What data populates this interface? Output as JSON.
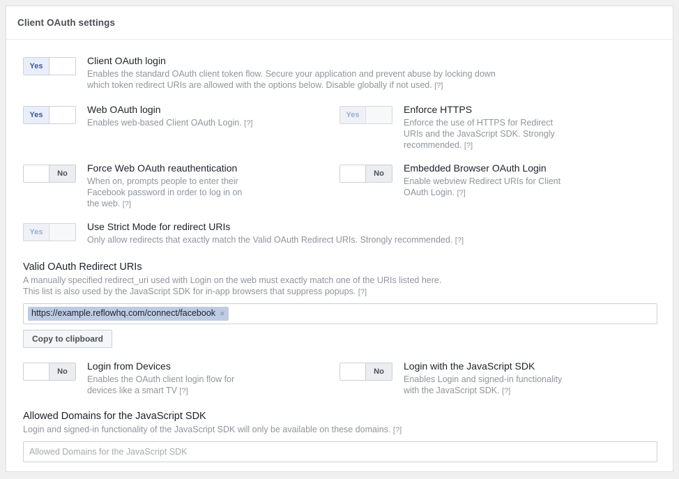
{
  "card": {
    "title": "Client OAuth settings"
  },
  "settings": [
    {
      "name": "client-oauth-login",
      "title": "Client OAuth login",
      "desc": "Enables the standard OAuth client token flow. Secure your application and prevent abuse by locking down which token redirect URIs are allowed with the options below. Disable globally if not used.",
      "help": "[?]",
      "state": "Yes",
      "on": true,
      "disabled": false
    },
    {
      "name": "web-oauth-login",
      "title": "Web OAuth login",
      "desc": "Enables web-based Client OAuth Login.",
      "help": "[?]",
      "state": "Yes",
      "on": true,
      "disabled": false
    },
    {
      "name": "enforce-https",
      "title": "Enforce HTTPS",
      "desc": "Enforce the use of HTTPS for Redirect URIs and the JavaScript SDK. Strongly recommended.",
      "help": "[?]",
      "state": "Yes",
      "on": true,
      "disabled": true
    },
    {
      "name": "force-web-oauth-reauthentication",
      "title": "Force Web OAuth reauthentication",
      "desc": "When on, prompts people to enter their Facebook password in order to log in on the web.",
      "help": "[?]",
      "state": "No",
      "on": false,
      "disabled": false
    },
    {
      "name": "embedded-browser-oauth-login",
      "title": "Embedded Browser OAuth Login",
      "desc": "Enable webview Redirect URIs for Client OAuth Login.",
      "help": "[?]",
      "state": "No",
      "on": false,
      "disabled": false
    },
    {
      "name": "use-strict-mode-for-redirect-uris",
      "title": "Use Strict Mode for redirect URIs",
      "desc": "Only allow redirects that exactly match the Valid OAuth Redirect URIs. Strongly recommended.",
      "help": "[?]",
      "state": "Yes",
      "on": true,
      "disabled": true
    },
    {
      "name": "login-from-devices",
      "title": "Login from Devices",
      "desc": "Enables the OAuth client login flow for devices like a smart TV",
      "help": "[?]",
      "state": "No",
      "on": false,
      "disabled": false
    },
    {
      "name": "login-with-the-javascript-sdk",
      "title": "Login with the JavaScript SDK",
      "desc": "Enables Login and signed-in functionality with the JavaScript SDK.",
      "help": "[?]",
      "state": "No",
      "on": false,
      "disabled": false
    }
  ],
  "redirect_uris": {
    "title": "Valid OAuth Redirect URIs",
    "desc_line1": "A manually specified redirect_uri used with Login on the web must exactly match one of the URIs listed here.",
    "desc_line2": "This list is also used by the JavaScript SDK for in-app browsers that suppress popups.",
    "help": "[?]",
    "tokens": [
      {
        "label": "https://example.reflowhq.com/connect/facebook",
        "remove": "×"
      }
    ],
    "copy_button": "Copy to clipboard"
  },
  "allowed_domains": {
    "title": "Allowed Domains for the JavaScript SDK",
    "desc": "Login and signed-in functionality of the JavaScript SDK will only be available on these domains.",
    "help": "[?]",
    "value": "",
    "placeholder": "Allowed Domains for the JavaScript SDK"
  },
  "colors": {
    "accent_blue": "#3b5998",
    "accent_blue_disabled": "#9aaed6",
    "token_bg": "#bdcce3",
    "text_primary": "#1d2129",
    "text_muted": "#90949c",
    "border": "#ccd0d5"
  }
}
